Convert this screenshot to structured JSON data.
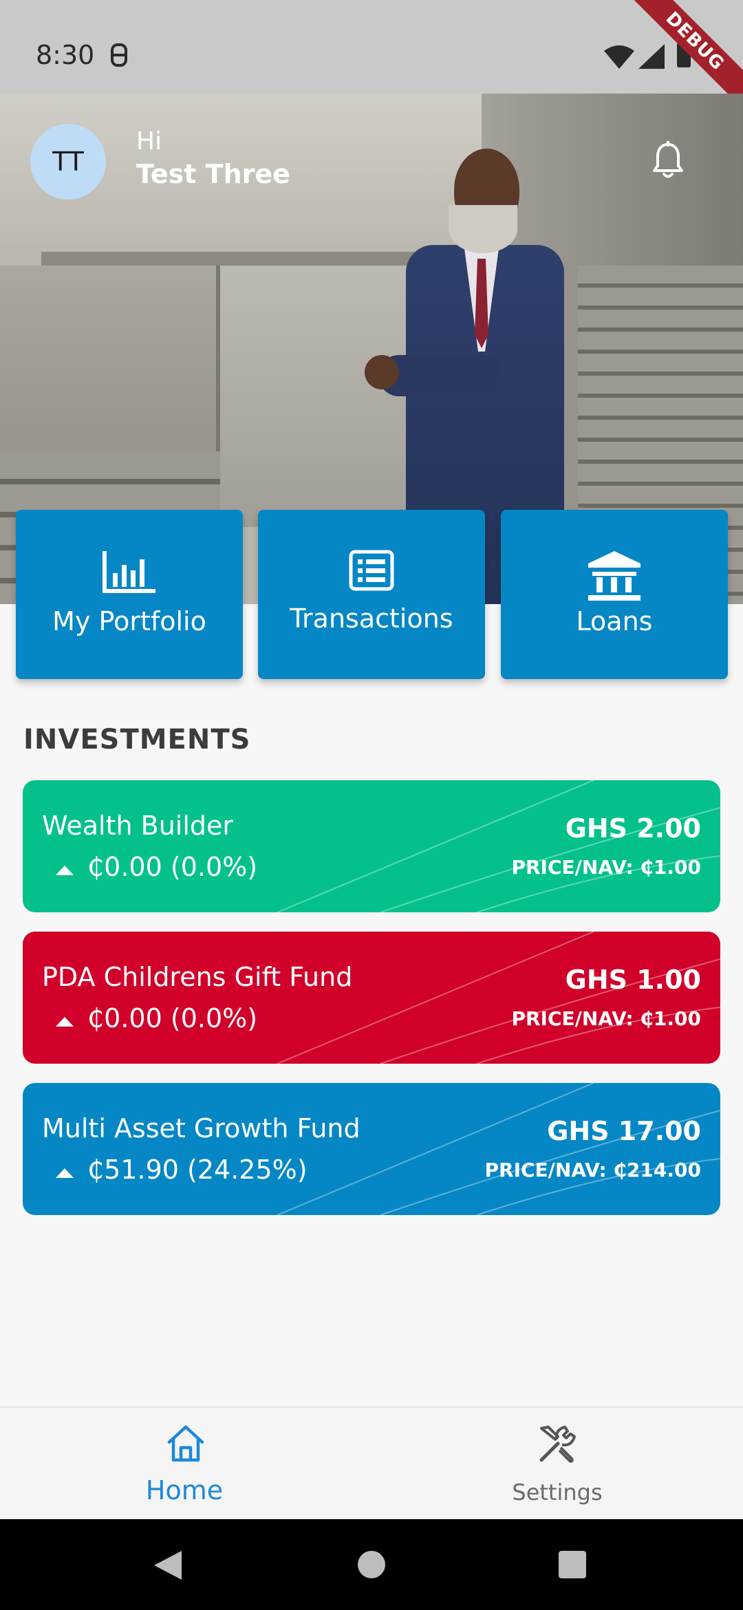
{
  "status_bar": {
    "time": "8:30",
    "debug_label": "DEBUG"
  },
  "header": {
    "avatar_initials": "TT",
    "greeting": "Hi",
    "user_name": "Test Three",
    "icons": [
      "bell-icon"
    ]
  },
  "actions": [
    {
      "label": "My Portfolio",
      "icon": "bar-chart-icon"
    },
    {
      "label": "Transactions",
      "icon": "list-icon"
    },
    {
      "label": "Loans",
      "icon": "bank-icon"
    }
  ],
  "investments": {
    "title": "INVESTMENTS",
    "funds": [
      {
        "name": "Wealth Builder",
        "change": "₵0.00 (0.0%)",
        "value": "GHS 2.00",
        "nav": "PRICE/NAV: ₵1.00",
        "color": "#04c18b",
        "trend": "up"
      },
      {
        "name": "PDA Childrens Gift Fund",
        "change": "₵0.00 (0.0%)",
        "value": "GHS 1.00",
        "nav": "PRICE/NAV: ₵1.00",
        "color": "#d0002a",
        "trend": "up"
      },
      {
        "name": "Multi Asset Growth Fund",
        "change": "₵51.90 (24.25%)",
        "value": "GHS 17.00",
        "nav": "PRICE/NAV: ₵214.00",
        "color": "#0587c5",
        "trend": "up"
      }
    ]
  },
  "bottom_nav": {
    "items": [
      {
        "label": "Home",
        "icon": "home-icon",
        "active": true,
        "color": "#1e88d8"
      },
      {
        "label": "Settings",
        "icon": "tools-icon",
        "active": false,
        "color": "#6a6a6a"
      }
    ]
  },
  "colors": {
    "tile_blue": "#0587c5",
    "background": "#f7f7f7"
  }
}
